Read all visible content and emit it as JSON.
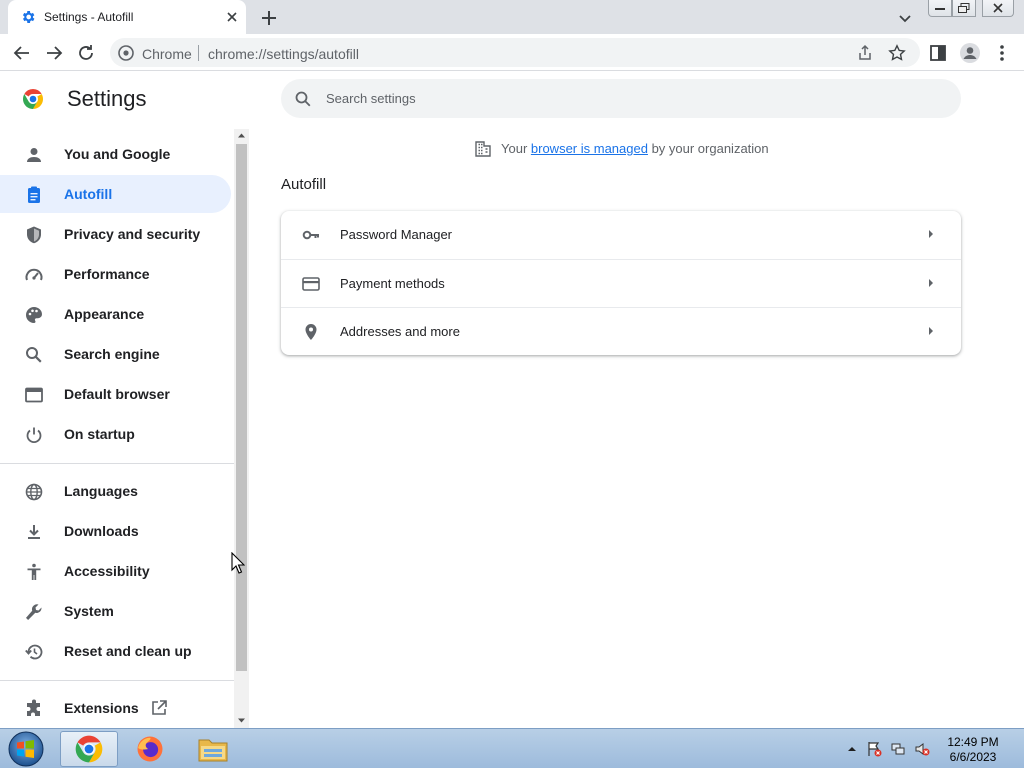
{
  "tab": {
    "title": "Settings - Autofill",
    "favicon": "gear-icon"
  },
  "toolbar": {
    "origin": "Chrome",
    "url": "chrome://settings/autofill"
  },
  "header": {
    "title": "Settings",
    "search_placeholder": "Search settings"
  },
  "sidebar": {
    "items": [
      {
        "label": "You and Google",
        "icon": "person-icon"
      },
      {
        "label": "Autofill",
        "icon": "clipboard-icon",
        "active": true
      },
      {
        "label": "Privacy and security",
        "icon": "shield-icon"
      },
      {
        "label": "Performance",
        "icon": "speedometer-icon"
      },
      {
        "label": "Appearance",
        "icon": "palette-icon"
      },
      {
        "label": "Search engine",
        "icon": "search-icon"
      },
      {
        "label": "Default browser",
        "icon": "browser-window-icon"
      },
      {
        "label": "On startup",
        "icon": "power-icon"
      },
      {
        "label": "Languages",
        "icon": "globe-icon"
      },
      {
        "label": "Downloads",
        "icon": "download-icon"
      },
      {
        "label": "Accessibility",
        "icon": "accessibility-icon"
      },
      {
        "label": "System",
        "icon": "wrench-icon"
      },
      {
        "label": "Reset and clean up",
        "icon": "history-icon"
      },
      {
        "label": "Extensions",
        "icon": "puzzle-icon"
      }
    ]
  },
  "main": {
    "managed_prefix": "Your ",
    "managed_link": "browser is managed",
    "managed_suffix": " by your organization",
    "section_title": "Autofill",
    "rows": [
      {
        "label": "Password Manager",
        "icon": "key-icon"
      },
      {
        "label": "Payment methods",
        "icon": "credit-card-icon"
      },
      {
        "label": "Addresses and more",
        "icon": "location-pin-icon"
      }
    ]
  },
  "taskbar": {
    "time": "12:49 PM",
    "date": "6/6/2023"
  },
  "colors": {
    "accent": "#1a73e8",
    "active_bg": "#e8f0fe",
    "tab_strip": "#dee1e6"
  }
}
